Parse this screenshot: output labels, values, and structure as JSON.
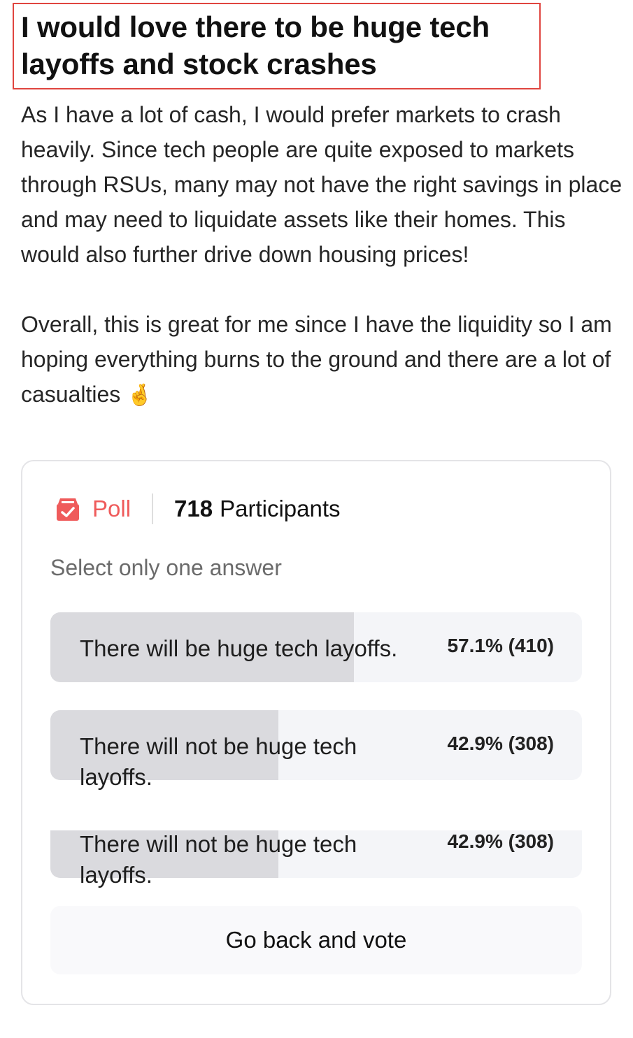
{
  "post": {
    "title": "I would love there to be huge tech layoffs and stock crashes",
    "paragraph1": "As I have a lot of cash, I would prefer markets to crash heavily. Since tech people are quite exposed to markets through RSUs, many may not have the right savings in place and may need to liquidate assets like their homes. This would also further drive down housing prices!",
    "paragraph2": "Overall, this is great for me since I have the liquidity so I am hoping everything burns to the ground and there are a lot of casualties",
    "emoji": "🤞"
  },
  "poll": {
    "label": "Poll",
    "icon": "ballot-box-icon",
    "participants_count": "718",
    "participants_label": "Participants",
    "instruction": "Select only one answer",
    "options": [
      {
        "label": "There will be huge tech layoffs.",
        "result": "57.1% (410)",
        "fraction": 0.571
      },
      {
        "label": "There will not be huge tech layoffs.",
        "result": "42.9% (308)",
        "fraction": 0.429
      },
      {
        "label": "There will not be huge tech layoffs.",
        "result": "42.9% (308)",
        "fraction": 0.429
      }
    ],
    "vote_button_label": "Go back and vote"
  },
  "colors": {
    "accent": "#ef5b5b",
    "highlight_border": "#e0453f",
    "option_fill": "#dadade",
    "option_background": "#f4f5f8"
  }
}
